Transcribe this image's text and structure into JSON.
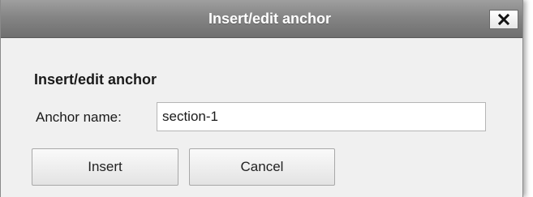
{
  "dialog": {
    "title": "Insert/edit anchor",
    "close_icon": "close-x-icon"
  },
  "form": {
    "heading": "Insert/edit anchor",
    "anchor_label": "Anchor name:",
    "anchor_value": "section-1"
  },
  "buttons": {
    "insert_label": "Insert",
    "cancel_label": "Cancel"
  },
  "colors": {
    "titlebar": "#858585",
    "background": "#f0f0f0",
    "title_text": "#ffffff"
  }
}
